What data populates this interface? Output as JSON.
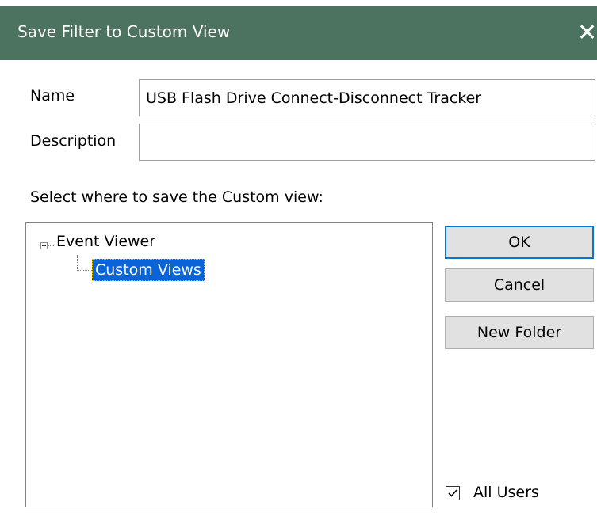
{
  "window": {
    "title": "Save Filter to Custom View",
    "close_icon": "close-icon"
  },
  "form": {
    "name_label": "Name",
    "name_value": "USB Flash Drive Connect-Disconnect Tracker",
    "description_label": "Description",
    "description_value": "",
    "select_label": "Select where to save the Custom view:"
  },
  "tree": {
    "root": "Event Viewer",
    "child": "Custom Views",
    "selected": "Custom Views"
  },
  "buttons": {
    "ok": "OK",
    "cancel": "Cancel",
    "new_folder": "New Folder"
  },
  "options": {
    "all_users_label": "All Users",
    "all_users_checked": true
  },
  "colors": {
    "titlebar": "#4b7360",
    "selection": "#0a64d8",
    "default_button_border": "#0078d7"
  }
}
